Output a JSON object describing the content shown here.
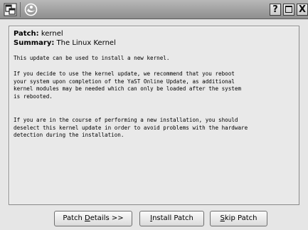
{
  "titlebar": {
    "icons": [
      "window-menu-icon",
      "yast-logo-icon"
    ],
    "help_label": "?",
    "close_label": "X"
  },
  "patch": {
    "patch_label": "Patch:",
    "patch_value": "kernel",
    "summary_label": "Summary:",
    "summary_value": "The Linux Kernel"
  },
  "description": {
    "p1": "This update can be used to install a new kernel.",
    "p2": "If you decide to use the kernel update, we recommend that you reboot\nyour system upon completion of the YaST Online Update, as additional\nkernel modules may be needed which can only be loaded after the system\nis rebooted.",
    "p3": "If you are in the course of performing a new installation, you should\ndeselect this kernel update in order to avoid problems with the hardware\ndetection during the installation."
  },
  "buttons": {
    "details_pre": "Patch ",
    "details_mnemonic": "D",
    "details_post": "etails >>",
    "install_mnemonic": "I",
    "install_post": "nstall Patch",
    "skip_mnemonic": "S",
    "skip_post": "kip Patch"
  }
}
